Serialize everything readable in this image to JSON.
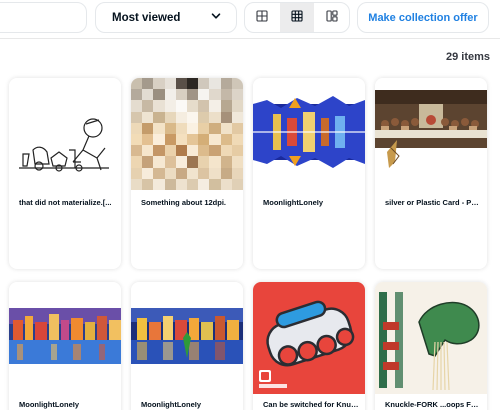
{
  "toolbar": {
    "sort_label": "Most viewed",
    "offer_label": "Make collection offer"
  },
  "results": {
    "count_label": "29 items"
  },
  "items": [
    {
      "name": "that did not materialize.[..."
    },
    {
      "name": "Something about 12dpi."
    },
    {
      "name": "MoonlightLoneIy"
    },
    {
      "name": "silver or Plastic Card - Phi..."
    },
    {
      "name": "MoonlightLoneIy"
    },
    {
      "name": "MoonlightLoneIy"
    },
    {
      "name": "Can be switched for Knuc..."
    },
    {
      "name": "Knuckle-FORK ...oops FOL..."
    }
  ],
  "colors": {
    "accent": "#2081e2",
    "text": "#04111d",
    "border": "#e5e8eb",
    "active_toggle": "#ececed"
  }
}
